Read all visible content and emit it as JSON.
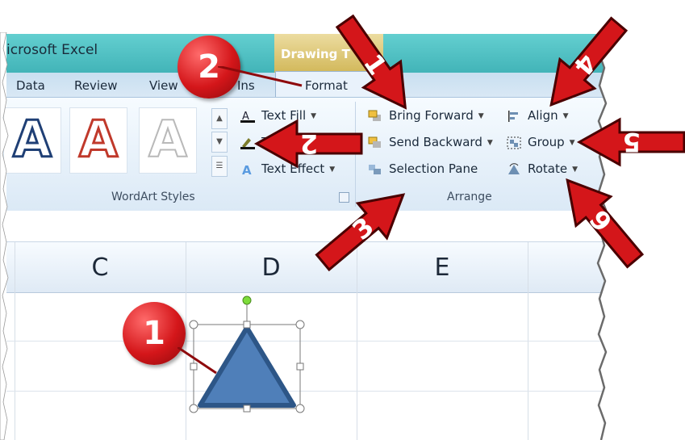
{
  "window": {
    "title": "icrosoft Excel",
    "context_tab": "Drawing T"
  },
  "tabs": [
    {
      "label": "Data"
    },
    {
      "label": "Review"
    },
    {
      "label": "View"
    },
    {
      "label": "Ins"
    },
    {
      "label": "Format"
    }
  ],
  "ribbon": {
    "wordart_styles": {
      "gallery_glyph": "A",
      "group_label": "WordArt Styles",
      "text_fill": "Text Fill",
      "text_outline": "T",
      "text_effects": "Text Effect"
    },
    "arrange": {
      "group_label": "Arrange",
      "bring_forward": "Bring Forward",
      "send_backward": "Send Backward",
      "selection_pane": "Selection Pane",
      "align": "Align",
      "group": "Group",
      "rotate": "Rotate"
    }
  },
  "sheet": {
    "columns": [
      "C",
      "D",
      "E"
    ]
  },
  "callouts": [
    "1",
    "2"
  ],
  "arrows": [
    "1",
    "2",
    "3",
    "4",
    "5",
    "6"
  ],
  "colors": {
    "callout": "#d4161a",
    "arrow": "#d4161a",
    "shape_fill": "#4f7fb9",
    "shape_border": "#2d5687"
  }
}
